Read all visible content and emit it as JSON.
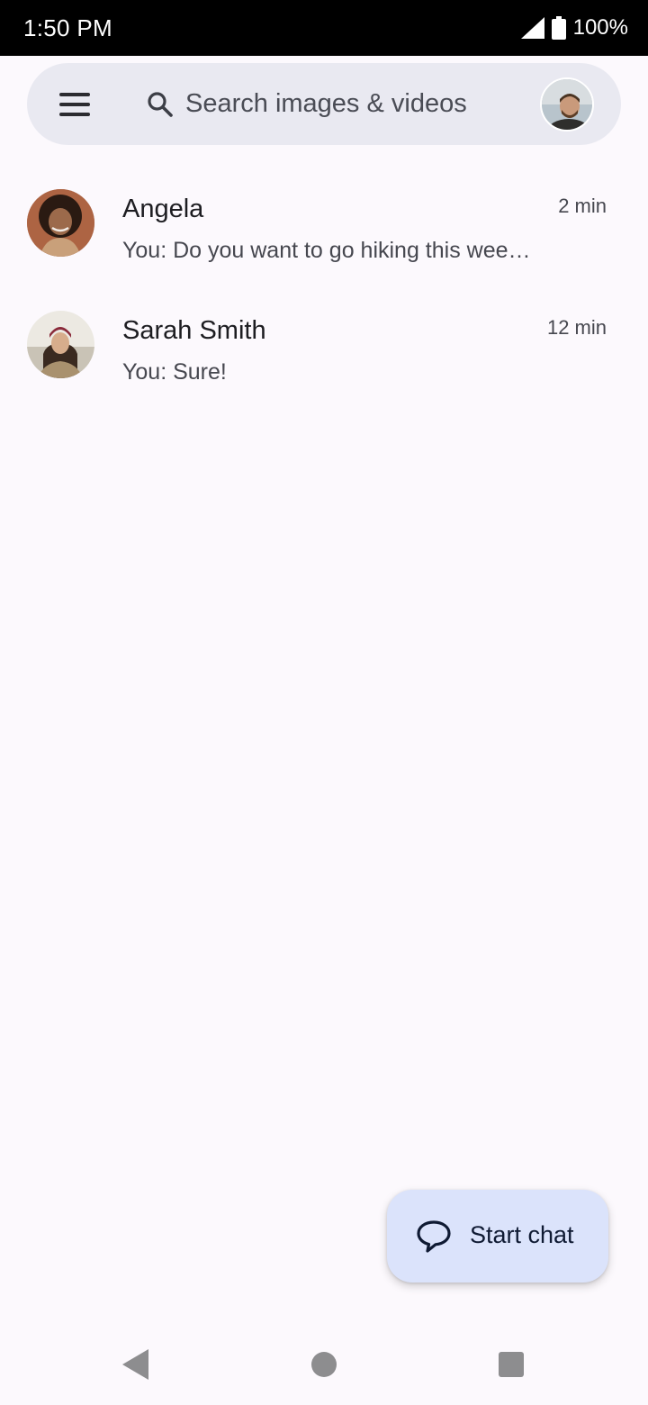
{
  "status_bar": {
    "time": "1:50 PM",
    "battery_text": "100%",
    "icons": [
      "signal-icon",
      "battery-icon"
    ]
  },
  "search": {
    "placeholder": "Search images & videos",
    "menu_icon": "menu-icon",
    "search_icon": "search-icon",
    "account_icon": "avatar"
  },
  "conversations": [
    {
      "name": "Angela",
      "snippet": "You: Do you want to go hiking this weekend?",
      "time": "2 min"
    },
    {
      "name": "Sarah Smith",
      "snippet": "You: Sure!",
      "time": "12 min"
    }
  ],
  "fab": {
    "label": "Start chat",
    "icon": "chat-bubble-icon"
  },
  "nav": {
    "icons": [
      "back-icon",
      "home-icon",
      "recents-icon"
    ]
  },
  "colors": {
    "background": "#fcf9fd",
    "search_bg": "#e9e9f1",
    "fab_bg": "#dbe3fb",
    "status_bar_bg": "#000000",
    "nav_icon": "#8d8d8f"
  }
}
